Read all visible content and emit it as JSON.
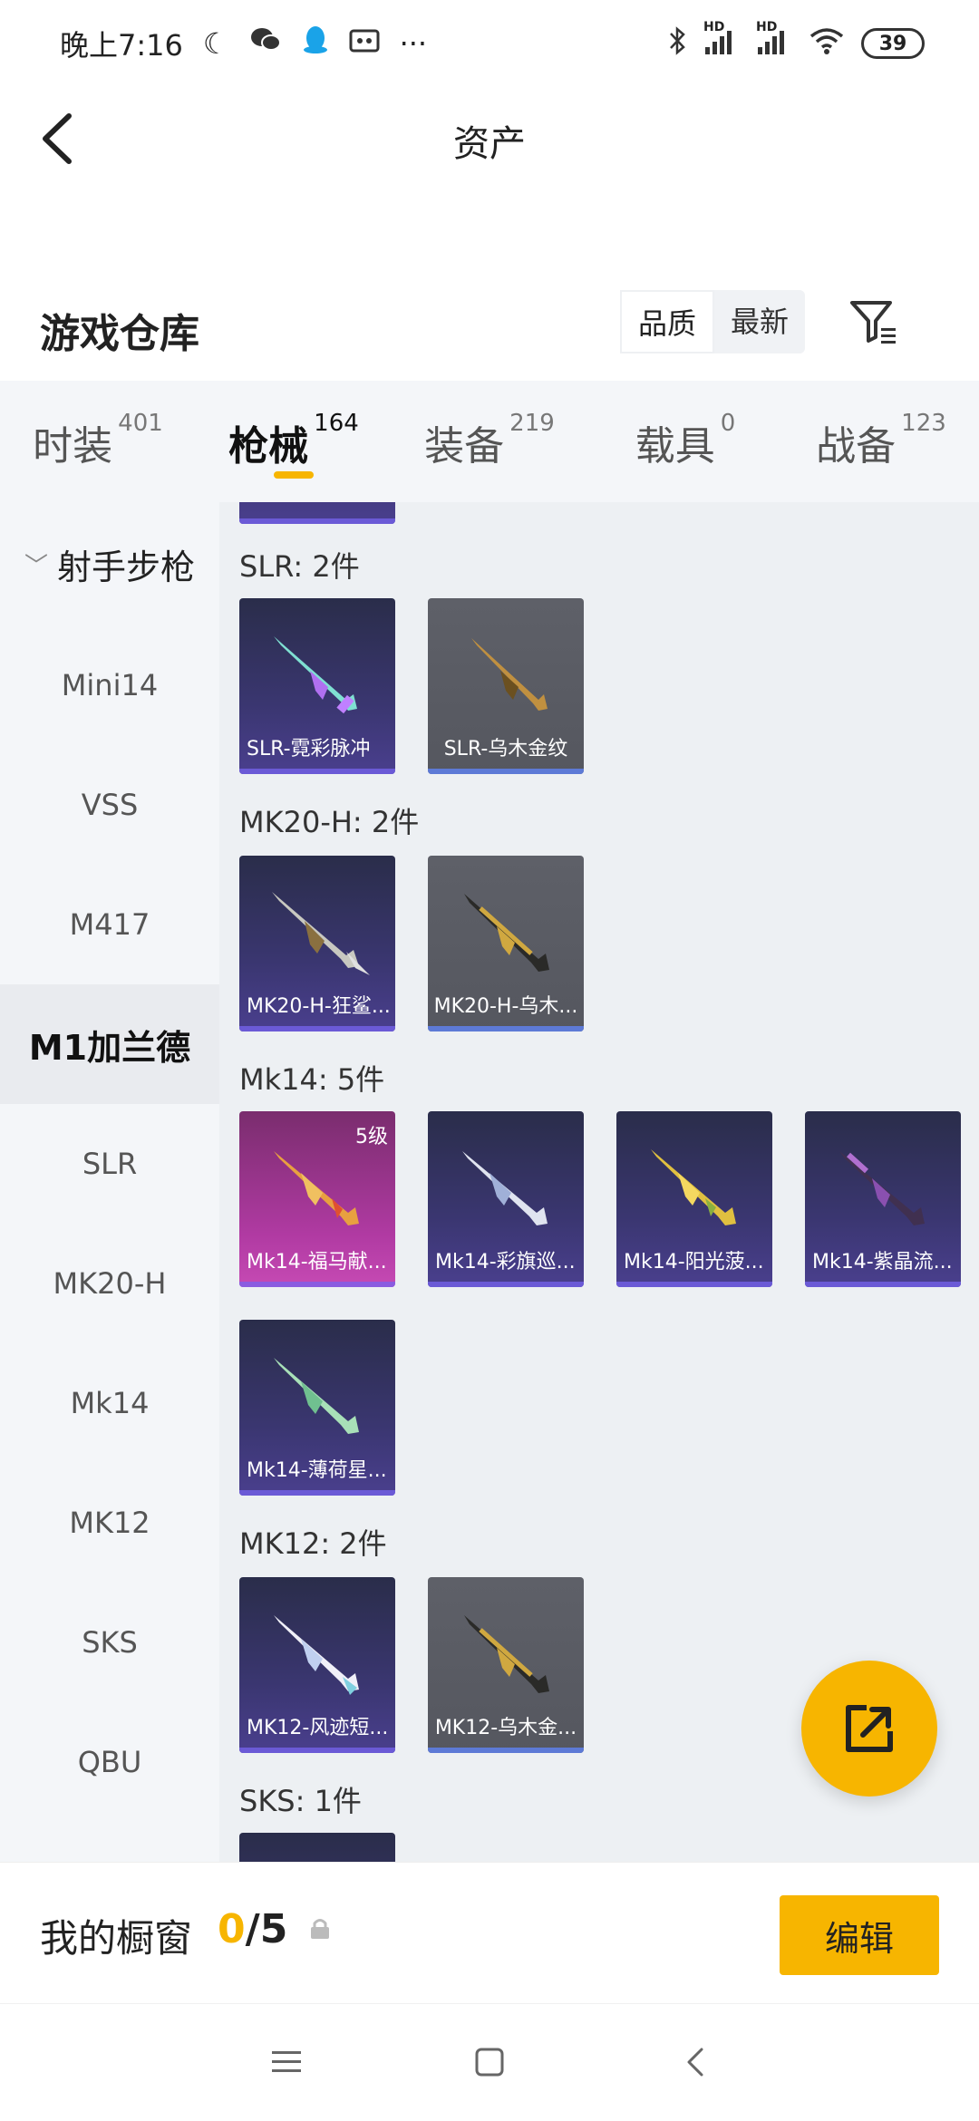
{
  "status": {
    "time": "晚上7:16",
    "battery": "39",
    "hd1": "HD",
    "hd2": "HD"
  },
  "header": {
    "title": "资产"
  },
  "warehouse": {
    "title": "游戏仓库",
    "sort_quality": "品质",
    "sort_newest": "最新"
  },
  "tabs": [
    {
      "label": "时装",
      "count": "401"
    },
    {
      "label": "枪械",
      "count": "164"
    },
    {
      "label": "装备",
      "count": "219"
    },
    {
      "label": "载具",
      "count": "0"
    },
    {
      "label": "战备",
      "count": "123"
    }
  ],
  "sidebar": {
    "group": "射手步枪",
    "items": [
      "Mini14",
      "VSS",
      "M417",
      "M1加兰德",
      "SLR",
      "MK20-H",
      "Mk14",
      "MK12",
      "SKS",
      "QBU"
    ]
  },
  "sections": [
    {
      "title": "SLR: 2件",
      "items": [
        "SLR-霓彩脉冲",
        "SLR-乌木金纹"
      ]
    },
    {
      "title": "MK20-H: 2件",
      "items": [
        "MK20-H-狂鲨...",
        "MK20-H-乌木..."
      ]
    },
    {
      "title": "Mk14: 5件",
      "items": [
        "Mk14-福马献...",
        "Mk14-彩旗巡...",
        "Mk14-阳光菠...",
        "Mk14-紫晶流...",
        "Mk14-薄荷星..."
      ],
      "level": "5级"
    },
    {
      "title": "MK12: 2件",
      "items": [
        "MK12-风迹短...",
        "MK12-乌木金..."
      ]
    },
    {
      "title": "SKS: 1件",
      "items": []
    }
  ],
  "showcase": {
    "label": "我的橱窗",
    "filled": "0",
    "total": "/5",
    "edit": "编辑"
  },
  "icons": {
    "back": "back-arrow-icon",
    "filter": "filter-icon",
    "share": "share-export-icon",
    "lock": "lock-icon"
  },
  "colors": {
    "accent": "#f7b500",
    "card_purple": "#3a3670",
    "card_gray": "#5e6068",
    "card_pink": "#b03aa2"
  }
}
